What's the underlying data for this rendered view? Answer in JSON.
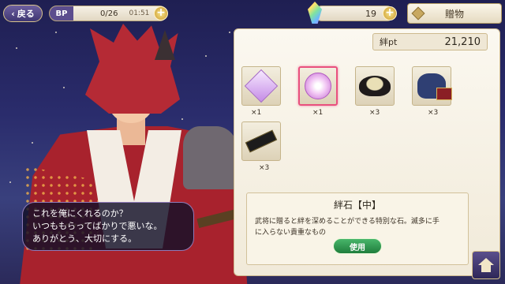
{
  "topbar": {
    "back_label": "戻る",
    "bp_label": "BP",
    "bp_value": "0/26",
    "bp_timer": "01:51",
    "gem_count": "19",
    "gift_label": "贈物"
  },
  "kizuna": {
    "label": "絆pt",
    "value": "21,210"
  },
  "items": [
    {
      "icon": "lavender-stone-icon",
      "qty": "×1"
    },
    {
      "icon": "pink-orb-icon",
      "qty": "×1",
      "selected": true
    },
    {
      "icon": "lacquer-bowl-icon",
      "qty": "×3"
    },
    {
      "icon": "cloth-bag-icon",
      "qty": "×3"
    },
    {
      "icon": "inkstick-icon",
      "qty": "×3"
    }
  ],
  "description": {
    "title": "絆石【中】",
    "text_line1": "武将に贈ると絆を深めることができる特別な石。滅多に手",
    "text_line2": "に入らない貴重なもの",
    "use_label": "使用"
  },
  "dialogue": {
    "line1": "これを俺にくれるのか？",
    "line2": "いつももらってばかりで悪いな。",
    "line3": "ありがとう、大切にする。"
  },
  "colors": {
    "accent": "#e9507e",
    "button_green": "#2f9a52",
    "panel": "#fbf8f0",
    "night_sky": "#2a2c6c"
  }
}
